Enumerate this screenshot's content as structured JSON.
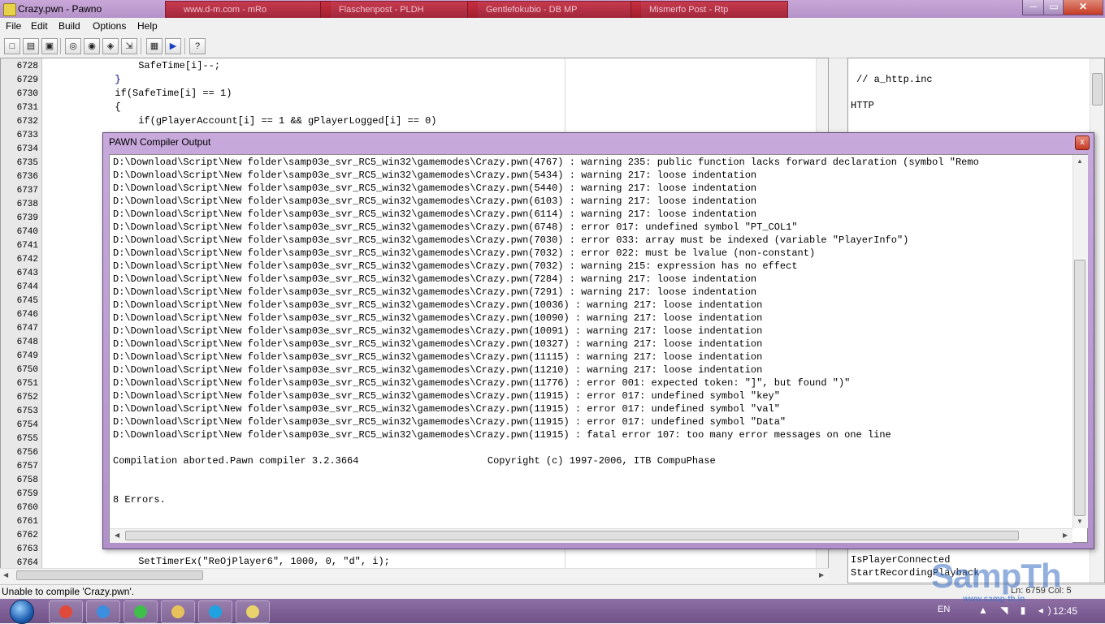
{
  "window": {
    "title": "Crazy.pwn - Pawno"
  },
  "background_tabs": [
    "",
    "www.d-m.com - mRo",
    "Flaschenpost - PLDH",
    "Gentlefokubio - DB MP",
    "Mismerfo Post - Rtp"
  ],
  "window_controls": {
    "minimize": "─",
    "maximize": "▭",
    "close": "✕"
  },
  "menu": [
    "File",
    "Edit",
    "Build",
    "Options",
    "Help"
  ],
  "toolbar": {
    "icons": [
      "new-file-icon",
      "open-file-icon",
      "save-icon",
      "find-icon",
      "find-next-icon",
      "replace-icon",
      "goto-icon",
      "compile-icon",
      "run-icon",
      "help-icon"
    ],
    "glyphs": [
      "□",
      "▤",
      "▣",
      "◎",
      "◉",
      "◈",
      "⇲",
      "▦",
      "▶",
      "?"
    ]
  },
  "editor": {
    "line_numbers": [
      "6728",
      "6729",
      "6730",
      "6731",
      "6732",
      "6733",
      "6734",
      "6735",
      "6736",
      "6737",
      "6738",
      "6739",
      "6740",
      "6741",
      "6742",
      "6743",
      "6744",
      "6745",
      "6746",
      "6747",
      "6748",
      "6749",
      "6750",
      "6751",
      "6752",
      "6753",
      "6754",
      "6755",
      "6756",
      "6757",
      "6758",
      "6759",
      "6760",
      "6761",
      "6762",
      "6763",
      "6764"
    ],
    "code_top": [
      "                SafeTime[i]--;",
      "            }",
      "            if(SafeTime[i] == 1)",
      "            {",
      "                if(gPlayerAccount[i] == 1 && gPlayerLogged[i] == 0)"
    ],
    "code_bottom": [
      "                SetTimerEx(\"ReOjPlayer6\", 1000, 0, \"d\", i);"
    ]
  },
  "right_panel": {
    "lines": [
      "// a_http.inc",
      "HTTP"
    ],
    "bottom_lines": [
      "IsPlayerConnected",
      "StartRecordingPlayback"
    ]
  },
  "dialog": {
    "title": "PAWN Compiler Output",
    "close": "x",
    "output": [
      "D:\\Download\\Script\\New folder\\samp03e_svr_RC5_win32\\gamemodes\\Crazy.pwn(4767) : warning 235: public function lacks forward declaration (symbol \"Remo",
      "D:\\Download\\Script\\New folder\\samp03e_svr_RC5_win32\\gamemodes\\Crazy.pwn(5434) : warning 217: loose indentation",
      "D:\\Download\\Script\\New folder\\samp03e_svr_RC5_win32\\gamemodes\\Crazy.pwn(5440) : warning 217: loose indentation",
      "D:\\Download\\Script\\New folder\\samp03e_svr_RC5_win32\\gamemodes\\Crazy.pwn(6103) : warning 217: loose indentation",
      "D:\\Download\\Script\\New folder\\samp03e_svr_RC5_win32\\gamemodes\\Crazy.pwn(6114) : warning 217: loose indentation",
      "D:\\Download\\Script\\New folder\\samp03e_svr_RC5_win32\\gamemodes\\Crazy.pwn(6748) : error 017: undefined symbol \"PT_COL1\"",
      "D:\\Download\\Script\\New folder\\samp03e_svr_RC5_win32\\gamemodes\\Crazy.pwn(7030) : error 033: array must be indexed (variable \"PlayerInfo\")",
      "D:\\Download\\Script\\New folder\\samp03e_svr_RC5_win32\\gamemodes\\Crazy.pwn(7032) : error 022: must be lvalue (non-constant)",
      "D:\\Download\\Script\\New folder\\samp03e_svr_RC5_win32\\gamemodes\\Crazy.pwn(7032) : warning 215: expression has no effect",
      "D:\\Download\\Script\\New folder\\samp03e_svr_RC5_win32\\gamemodes\\Crazy.pwn(7284) : warning 217: loose indentation",
      "D:\\Download\\Script\\New folder\\samp03e_svr_RC5_win32\\gamemodes\\Crazy.pwn(7291) : warning 217: loose indentation",
      "D:\\Download\\Script\\New folder\\samp03e_svr_RC5_win32\\gamemodes\\Crazy.pwn(10036) : warning 217: loose indentation",
      "D:\\Download\\Script\\New folder\\samp03e_svr_RC5_win32\\gamemodes\\Crazy.pwn(10090) : warning 217: loose indentation",
      "D:\\Download\\Script\\New folder\\samp03e_svr_RC5_win32\\gamemodes\\Crazy.pwn(10091) : warning 217: loose indentation",
      "D:\\Download\\Script\\New folder\\samp03e_svr_RC5_win32\\gamemodes\\Crazy.pwn(10327) : warning 217: loose indentation",
      "D:\\Download\\Script\\New folder\\samp03e_svr_RC5_win32\\gamemodes\\Crazy.pwn(11115) : warning 217: loose indentation",
      "D:\\Download\\Script\\New folder\\samp03e_svr_RC5_win32\\gamemodes\\Crazy.pwn(11210) : warning 217: loose indentation",
      "D:\\Download\\Script\\New folder\\samp03e_svr_RC5_win32\\gamemodes\\Crazy.pwn(11776) : error 001: expected token: \"]\", but found \")\"",
      "D:\\Download\\Script\\New folder\\samp03e_svr_RC5_win32\\gamemodes\\Crazy.pwn(11915) : error 017: undefined symbol \"key\"",
      "D:\\Download\\Script\\New folder\\samp03e_svr_RC5_win32\\gamemodes\\Crazy.pwn(11915) : error 017: undefined symbol \"val\"",
      "D:\\Download\\Script\\New folder\\samp03e_svr_RC5_win32\\gamemodes\\Crazy.pwn(11915) : error 017: undefined symbol \"Data\"",
      "D:\\Download\\Script\\New folder\\samp03e_svr_RC5_win32\\gamemodes\\Crazy.pwn(11915) : fatal error 107: too many error messages on one line",
      "",
      "Compilation aborted.Pawn compiler 3.2.3664                      Copyright (c) 1997-2006, ITB CompuPhase",
      "",
      "",
      "8 Errors."
    ]
  },
  "statusbar": {
    "message": "Unable to compile 'Crazy.pwn'.",
    "position": "Ln: 6759   Col: 5"
  },
  "taskbar": {
    "apps": [
      "chrome-icon",
      "ie-icon",
      "line-icon",
      "explorer-icon",
      "skype-icon",
      "pawno-icon"
    ],
    "app_colors": [
      "#e04a3a",
      "#3c8ede",
      "#3fbf4a",
      "#e7c25a",
      "#1fa3e0",
      "#e9d36a"
    ],
    "language": "EN",
    "clock": "12:45",
    "tray": "▲ ◥ ▮ ◂)"
  },
  "watermark": {
    "brand": "SampTh",
    "url": "www.samp-th.in"
  }
}
